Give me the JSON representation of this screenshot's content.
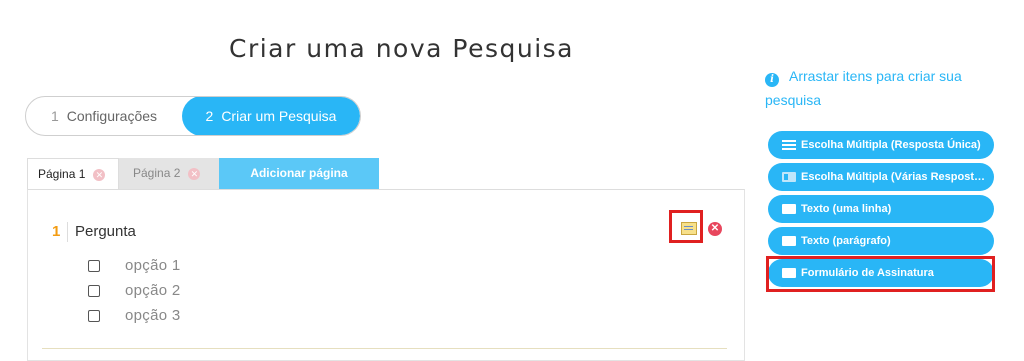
{
  "page": {
    "title": "Criar uma nova Pesquisa"
  },
  "steps": [
    {
      "num": "1",
      "label": "Configurações"
    },
    {
      "num": "2",
      "label": "Criar um Pesquisa"
    }
  ],
  "tabs": {
    "page1": "Página 1",
    "page2": "Página 2",
    "add": "Adicionar página"
  },
  "question": {
    "number": "1",
    "label": "Pergunta",
    "options": [
      "opção 1",
      "opção 2",
      "opção 3"
    ]
  },
  "sidebar": {
    "hint": "Arrastar itens para criar sua pesquisa",
    "items": [
      {
        "label": "Escolha Múltipla (Resposta Única)",
        "icon": "list-icon"
      },
      {
        "label": "Escolha Múltipla (Várias Respostas)",
        "icon": "checkbox-list-icon"
      },
      {
        "label": "Texto (uma linha)",
        "icon": "text-line-icon"
      },
      {
        "label": "Texto (parágrafo)",
        "icon": "text-paragraph-icon"
      },
      {
        "label": "Formulário de Assinatura",
        "icon": "signature-form-icon"
      }
    ]
  },
  "colors": {
    "accent": "#29b6f6",
    "highlight": "#e02020",
    "delete": "#e8465d",
    "question_number": "#f39c12"
  }
}
